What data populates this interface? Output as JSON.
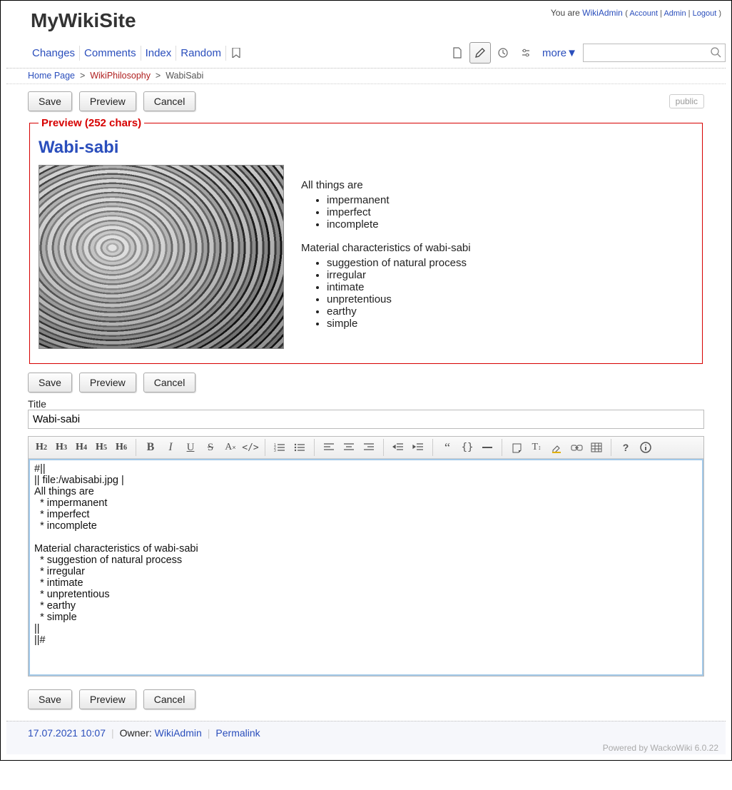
{
  "header": {
    "site_title": "MyWikiSite",
    "user_prefix": "You are ",
    "user_name": "WikiAdmin",
    "account": "Account",
    "admin": "Admin",
    "logout": "Logout"
  },
  "nav": {
    "items": [
      "Changes",
      "Comments",
      "Index",
      "Random"
    ],
    "more": "more▼"
  },
  "breadcrumb": {
    "home": "Home Page",
    "mid": "WikiPhilosophy",
    "current": "WabiSabi"
  },
  "buttons": {
    "save": "Save",
    "preview": "Preview",
    "cancel": "Cancel",
    "public_badge": "public"
  },
  "preview": {
    "legend": "Preview (252 chars)",
    "title": "Wabi-sabi",
    "line1": "All things are",
    "list1": [
      "impermanent",
      "imperfect",
      "incomplete"
    ],
    "line2": "Material characteristics of wabi-sabi",
    "list2": [
      "suggestion of natural process",
      "irregular",
      "intimate",
      "unpretentious",
      "earthy",
      "simple"
    ]
  },
  "title_field": {
    "label": "Title",
    "value": "Wabi-sabi"
  },
  "editor": {
    "content": "#||\n|| file:/wabisabi.jpg |\nAll things are\n  * impermanent\n  * imperfect\n  * incomplete\n\nMaterial characteristics of wabi-sabi\n  * suggestion of natural process\n  * irregular\n  * intimate\n  * unpretentious\n  * earthy\n  * simple\n||\n||#"
  },
  "footer": {
    "date": "17.07.2021 10:07",
    "owner_label": "Owner: ",
    "owner": "WikiAdmin",
    "permalink": "Permalink",
    "powered_prefix": "Powered by ",
    "powered_link": "WackoWiki 6.0.22"
  }
}
